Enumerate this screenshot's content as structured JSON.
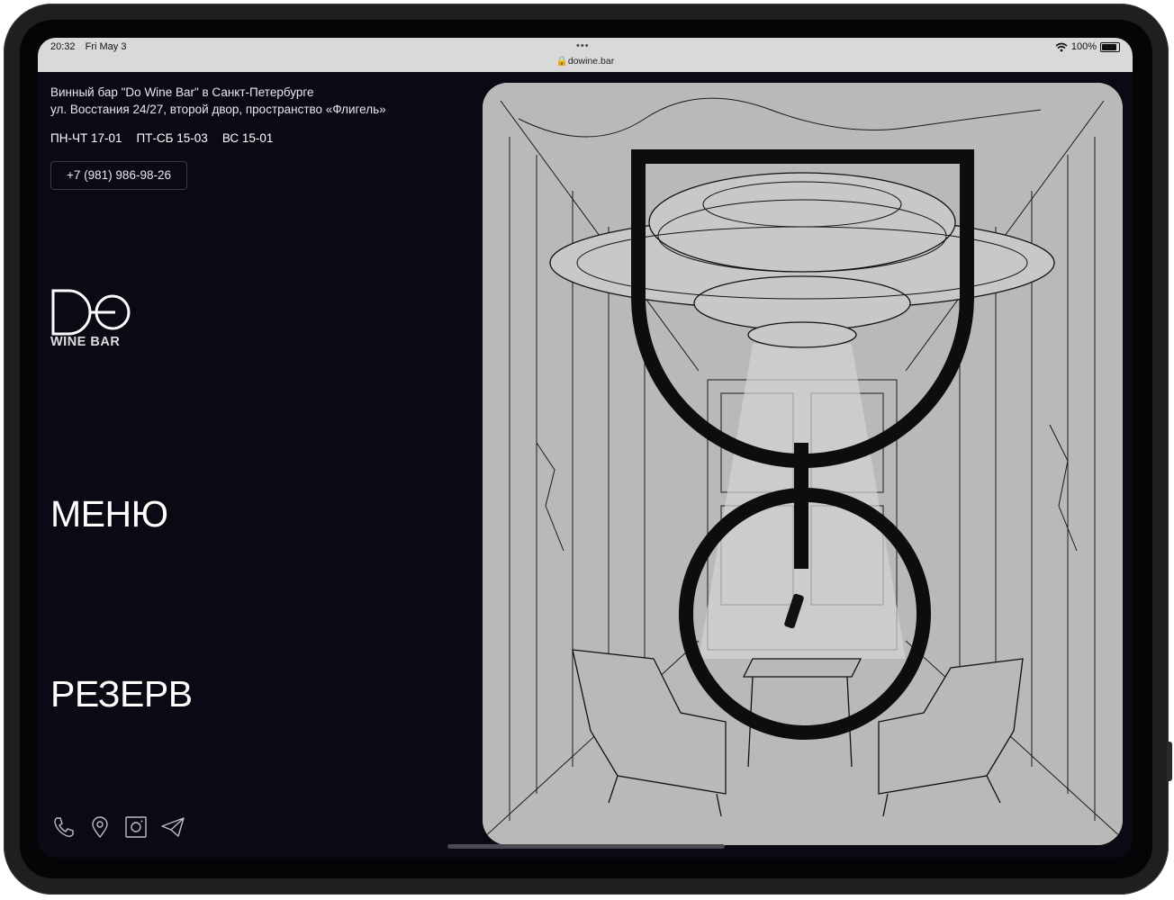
{
  "status_bar": {
    "time": "20:32",
    "date": "Fri May 3",
    "url": "dowine.bar",
    "battery": "100%"
  },
  "info": {
    "address_line1": "Винный бар \"Do Wine Bar\" в Санкт-Петербурге",
    "address_line2": "ул. Восстания 24/27, второй двор, пространство «Флигель»",
    "hours": [
      "ПН-ЧТ 17-01",
      "ПТ-СБ 15-03",
      "ВС 15-01"
    ],
    "phone": "+7 (981) 986-98-26"
  },
  "logo": {
    "title": "Do",
    "subtitle": "WINE BAR"
  },
  "nav": {
    "menu": "МЕНЮ",
    "reserve": "РЕЗЕРВ"
  },
  "social": [
    "phone-icon",
    "location-pin-icon",
    "instagram-icon",
    "telegram-icon"
  ],
  "colors": {
    "background": "#0b0a14",
    "text": "#ffffff",
    "hero": "#b9b9b9"
  }
}
